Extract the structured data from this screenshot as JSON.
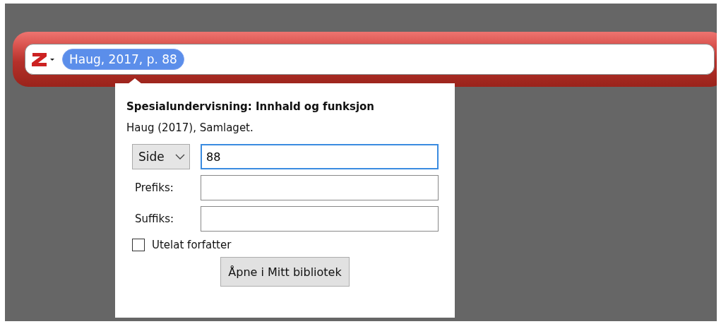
{
  "quick_format_bar": {
    "citation": {
      "label": "Haug, 2017, p. 88",
      "selected": true
    }
  },
  "popup": {
    "title": "Spesialundervisning: Innhald og funksjon",
    "summary": "Haug (2017), Samlaget.",
    "locator": {
      "type": "Side",
      "value": "88"
    },
    "fields": [
      {
        "label": "Prefiks:"
      },
      {
        "label": "Suffiks:"
      }
    ],
    "omit_author": {
      "label": "Utelat forfatter",
      "checked": false
    },
    "button": "Åpne i Mitt bibliotek"
  }
}
